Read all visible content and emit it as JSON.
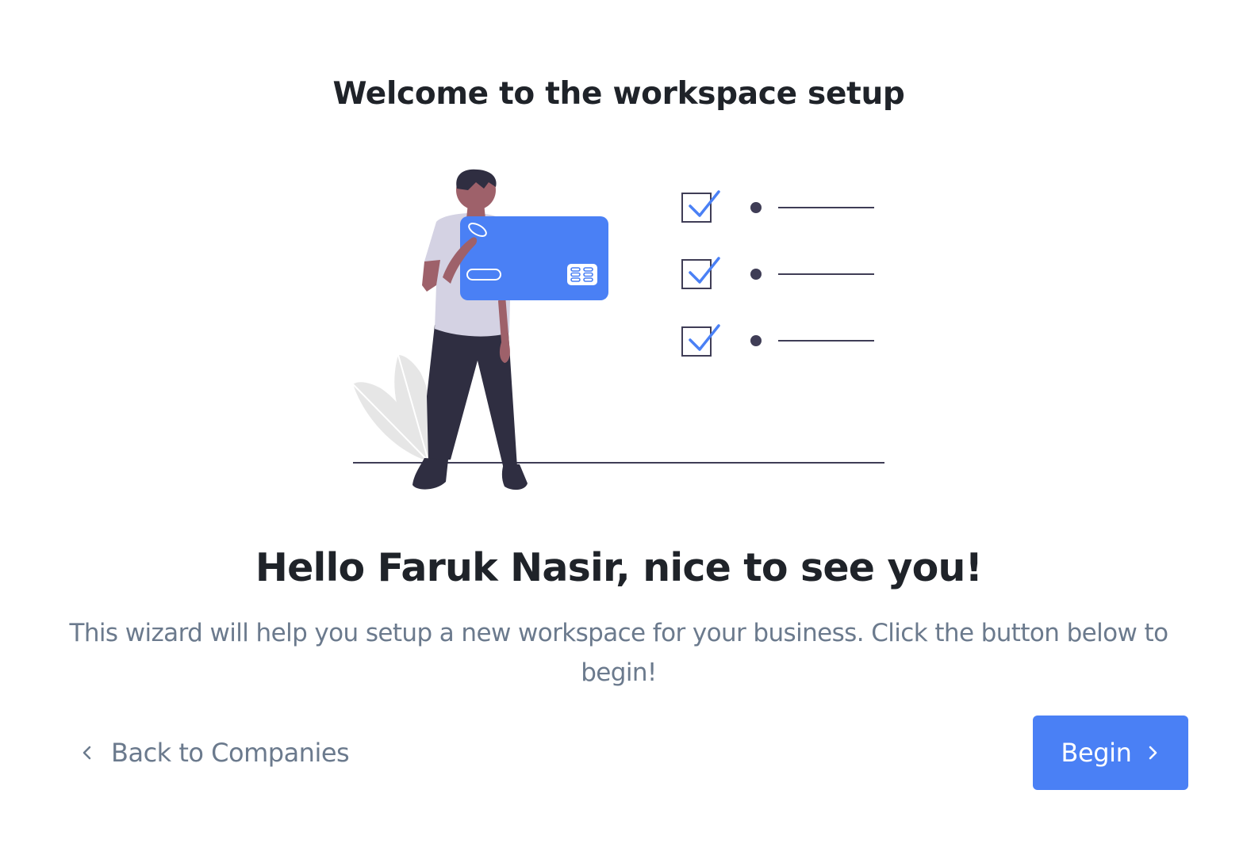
{
  "header": {
    "title": "Welcome to the workspace setup"
  },
  "illustration": {
    "icon": "person-holding-credit-card-checklist-illustration",
    "accent_color": "#4a80f5",
    "checklist_items": 3
  },
  "main": {
    "greeting": "Hello Faruk Nasir, nice to see you!",
    "description": "This wizard will help you setup a new workspace for your business. Click the button below to begin!"
  },
  "footer": {
    "back_label": "Back to Companies",
    "back_icon": "chevron-left-icon",
    "begin_label": "Begin",
    "begin_icon": "chevron-right-icon",
    "begin_color": "#4a80f5"
  }
}
